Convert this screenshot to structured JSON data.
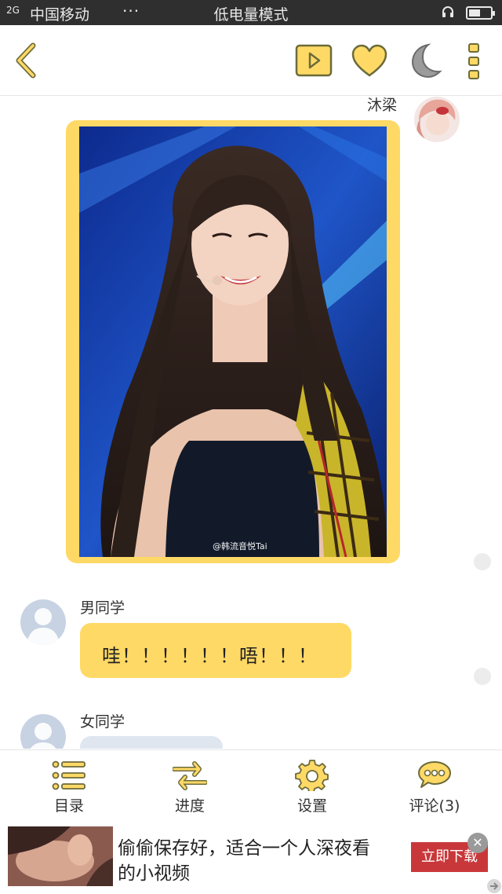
{
  "status_bar": {
    "network": "2G",
    "carrier": "中国移动",
    "more": "···",
    "mode": "低电量模式",
    "battery_level": 0.55
  },
  "nav": {
    "icons": [
      "back-icon",
      "play-video-icon",
      "heart-icon",
      "moon-icon",
      "more-vertical-icon"
    ]
  },
  "chat": {
    "messages": [
      {
        "sender": "沐梁",
        "side": "right",
        "type": "image",
        "watermark": "@韩流音悦Tai"
      },
      {
        "sender": "男同学",
        "side": "left",
        "type": "text",
        "text": "哇！！！！！！唔！！！"
      },
      {
        "sender": "女同学",
        "side": "left",
        "type": "text",
        "text": ""
      }
    ]
  },
  "toolbar": {
    "items": [
      {
        "label": "目录",
        "icon": "list-icon"
      },
      {
        "label": "进度",
        "icon": "swap-arrows-icon"
      },
      {
        "label": "设置",
        "icon": "gear-icon"
      },
      {
        "label": "评论(3)",
        "icon": "comment-icon"
      }
    ]
  },
  "ad": {
    "line1": "偷偷保存好，适合一个人深夜看",
    "line2": "的小视频",
    "cta": "立即下载",
    "close": "✕"
  },
  "colors": {
    "accent": "#ffd966",
    "icon_stroke": "#6b6b3a",
    "status_bar": "#2f2f2f",
    "ad_button": "#c8383a"
  }
}
